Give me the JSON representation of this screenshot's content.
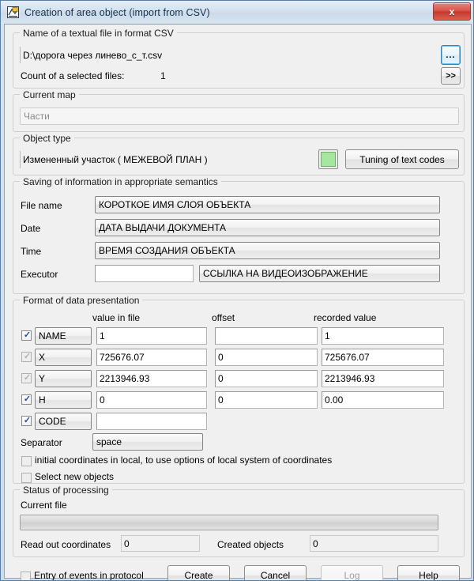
{
  "window": {
    "title": "Creation of area object (import from CSV)",
    "icon": "csv-import-icon",
    "close_label": "x"
  },
  "file_group": {
    "legend": "Name of a textual file in format CSV",
    "path_value": "D:\\дорога через линево_с_т.csv",
    "browse_label": "...",
    "expand_label": ">>",
    "count_label": "Count of a selected files:",
    "count_value": "1"
  },
  "current_map_group": {
    "legend": "Current map",
    "selected": "Части"
  },
  "object_type_group": {
    "legend": "Object type",
    "value": "Изменненый участок   ( МЕЖЕВОЙ ПЛАН )",
    "value_display": "Измененный участок   ( МЕЖЕВОЙ ПЛАН )",
    "swatch_color": "#a5e6a0",
    "tuning_label": "Tuning of text codes"
  },
  "semantics_group": {
    "legend": "Saving of information in appropriate semantics",
    "rows": [
      {
        "label": "File name",
        "value": "КОРОТКОЕ ИМЯ СЛОЯ ОБЪЕКТА"
      },
      {
        "label": "Date",
        "value": "ДАТА ВЫДАЧИ ДОКУМЕНТА"
      },
      {
        "label": "Time",
        "value": "ВРЕМЯ СОЗДАНИЯ ОБЪЕКТА"
      }
    ],
    "executor_label": "Executor",
    "executor_value": "",
    "executor_combo": "ССЫЛКА НА ВИДЕОИЗОБРАЖЕНИЕ"
  },
  "format_group": {
    "legend": "Format of data presentation",
    "columns": [
      "value in file",
      "offset",
      "recorded value"
    ],
    "rows": [
      {
        "checked": true,
        "enabled": true,
        "field": "NAME",
        "value_in_file": "1",
        "offset": "",
        "recorded": "1"
      },
      {
        "checked": true,
        "enabled": false,
        "field": "X",
        "value_in_file": "725676.07",
        "offset": "0",
        "recorded": "725676.07"
      },
      {
        "checked": true,
        "enabled": false,
        "field": "Y",
        "value_in_file": "2213946.93",
        "offset": "0",
        "recorded": "2213946.93"
      },
      {
        "checked": true,
        "enabled": true,
        "field": "H",
        "value_in_file": "0",
        "offset": "0",
        "recorded": "0.00"
      },
      {
        "checked": true,
        "enabled": true,
        "field": "CODE",
        "value_in_file": "",
        "offset": null,
        "recorded": null
      }
    ],
    "separator_label": "Separator",
    "separator_value": "space",
    "local_coords_label": "initial coordinates in local, to use options of local system of coordinates",
    "local_coords_checked": false,
    "select_new_label": "Select new objects",
    "select_new_checked": false
  },
  "status_group": {
    "legend": "Status of processing",
    "current_file_label": "Current file",
    "progress_percent": 0,
    "read_out_label": "Read out coordinates",
    "read_out_value": "0",
    "created_label": "Created objects",
    "created_value": "0"
  },
  "footer": {
    "protocol_label": "Entry of events in protocol",
    "protocol_checked": false,
    "create_label": "Create",
    "cancel_label": "Cancel",
    "log_label": "Log",
    "log_enabled": false,
    "help_label": "Help"
  }
}
